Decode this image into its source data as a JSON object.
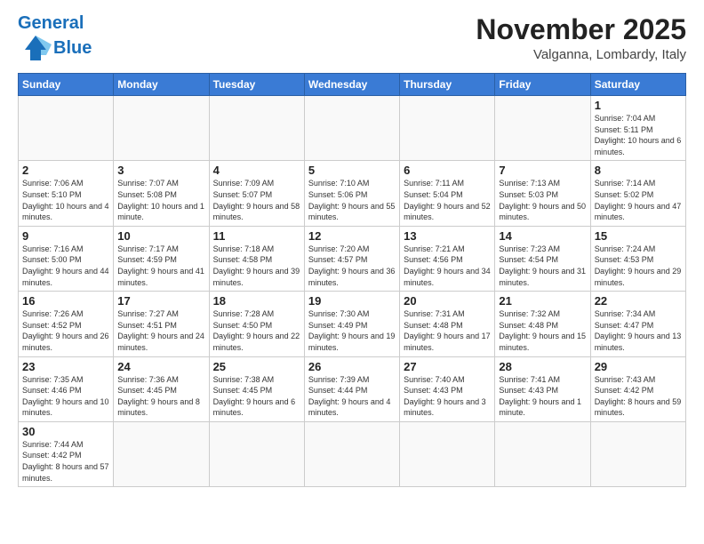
{
  "header": {
    "logo_general": "General",
    "logo_blue": "Blue",
    "month_title": "November 2025",
    "location": "Valganna, Lombardy, Italy"
  },
  "weekdays": [
    "Sunday",
    "Monday",
    "Tuesday",
    "Wednesday",
    "Thursday",
    "Friday",
    "Saturday"
  ],
  "weeks": [
    [
      {
        "day": "",
        "info": ""
      },
      {
        "day": "",
        "info": ""
      },
      {
        "day": "",
        "info": ""
      },
      {
        "day": "",
        "info": ""
      },
      {
        "day": "",
        "info": ""
      },
      {
        "day": "",
        "info": ""
      },
      {
        "day": "1",
        "info": "Sunrise: 7:04 AM\nSunset: 5:11 PM\nDaylight: 10 hours and 6 minutes."
      }
    ],
    [
      {
        "day": "2",
        "info": "Sunrise: 7:06 AM\nSunset: 5:10 PM\nDaylight: 10 hours and 4 minutes."
      },
      {
        "day": "3",
        "info": "Sunrise: 7:07 AM\nSunset: 5:08 PM\nDaylight: 10 hours and 1 minute."
      },
      {
        "day": "4",
        "info": "Sunrise: 7:09 AM\nSunset: 5:07 PM\nDaylight: 9 hours and 58 minutes."
      },
      {
        "day": "5",
        "info": "Sunrise: 7:10 AM\nSunset: 5:06 PM\nDaylight: 9 hours and 55 minutes."
      },
      {
        "day": "6",
        "info": "Sunrise: 7:11 AM\nSunset: 5:04 PM\nDaylight: 9 hours and 52 minutes."
      },
      {
        "day": "7",
        "info": "Sunrise: 7:13 AM\nSunset: 5:03 PM\nDaylight: 9 hours and 50 minutes."
      },
      {
        "day": "8",
        "info": "Sunrise: 7:14 AM\nSunset: 5:02 PM\nDaylight: 9 hours and 47 minutes."
      }
    ],
    [
      {
        "day": "9",
        "info": "Sunrise: 7:16 AM\nSunset: 5:00 PM\nDaylight: 9 hours and 44 minutes."
      },
      {
        "day": "10",
        "info": "Sunrise: 7:17 AM\nSunset: 4:59 PM\nDaylight: 9 hours and 41 minutes."
      },
      {
        "day": "11",
        "info": "Sunrise: 7:18 AM\nSunset: 4:58 PM\nDaylight: 9 hours and 39 minutes."
      },
      {
        "day": "12",
        "info": "Sunrise: 7:20 AM\nSunset: 4:57 PM\nDaylight: 9 hours and 36 minutes."
      },
      {
        "day": "13",
        "info": "Sunrise: 7:21 AM\nSunset: 4:56 PM\nDaylight: 9 hours and 34 minutes."
      },
      {
        "day": "14",
        "info": "Sunrise: 7:23 AM\nSunset: 4:54 PM\nDaylight: 9 hours and 31 minutes."
      },
      {
        "day": "15",
        "info": "Sunrise: 7:24 AM\nSunset: 4:53 PM\nDaylight: 9 hours and 29 minutes."
      }
    ],
    [
      {
        "day": "16",
        "info": "Sunrise: 7:26 AM\nSunset: 4:52 PM\nDaylight: 9 hours and 26 minutes."
      },
      {
        "day": "17",
        "info": "Sunrise: 7:27 AM\nSunset: 4:51 PM\nDaylight: 9 hours and 24 minutes."
      },
      {
        "day": "18",
        "info": "Sunrise: 7:28 AM\nSunset: 4:50 PM\nDaylight: 9 hours and 22 minutes."
      },
      {
        "day": "19",
        "info": "Sunrise: 7:30 AM\nSunset: 4:49 PM\nDaylight: 9 hours and 19 minutes."
      },
      {
        "day": "20",
        "info": "Sunrise: 7:31 AM\nSunset: 4:48 PM\nDaylight: 9 hours and 17 minutes."
      },
      {
        "day": "21",
        "info": "Sunrise: 7:32 AM\nSunset: 4:48 PM\nDaylight: 9 hours and 15 minutes."
      },
      {
        "day": "22",
        "info": "Sunrise: 7:34 AM\nSunset: 4:47 PM\nDaylight: 9 hours and 13 minutes."
      }
    ],
    [
      {
        "day": "23",
        "info": "Sunrise: 7:35 AM\nSunset: 4:46 PM\nDaylight: 9 hours and 10 minutes."
      },
      {
        "day": "24",
        "info": "Sunrise: 7:36 AM\nSunset: 4:45 PM\nDaylight: 9 hours and 8 minutes."
      },
      {
        "day": "25",
        "info": "Sunrise: 7:38 AM\nSunset: 4:45 PM\nDaylight: 9 hours and 6 minutes."
      },
      {
        "day": "26",
        "info": "Sunrise: 7:39 AM\nSunset: 4:44 PM\nDaylight: 9 hours and 4 minutes."
      },
      {
        "day": "27",
        "info": "Sunrise: 7:40 AM\nSunset: 4:43 PM\nDaylight: 9 hours and 3 minutes."
      },
      {
        "day": "28",
        "info": "Sunrise: 7:41 AM\nSunset: 4:43 PM\nDaylight: 9 hours and 1 minute."
      },
      {
        "day": "29",
        "info": "Sunrise: 7:43 AM\nSunset: 4:42 PM\nDaylight: 8 hours and 59 minutes."
      }
    ],
    [
      {
        "day": "30",
        "info": "Sunrise: 7:44 AM\nSunset: 4:42 PM\nDaylight: 8 hours and 57 minutes."
      },
      {
        "day": "",
        "info": ""
      },
      {
        "day": "",
        "info": ""
      },
      {
        "day": "",
        "info": ""
      },
      {
        "day": "",
        "info": ""
      },
      {
        "day": "",
        "info": ""
      },
      {
        "day": "",
        "info": ""
      }
    ]
  ]
}
